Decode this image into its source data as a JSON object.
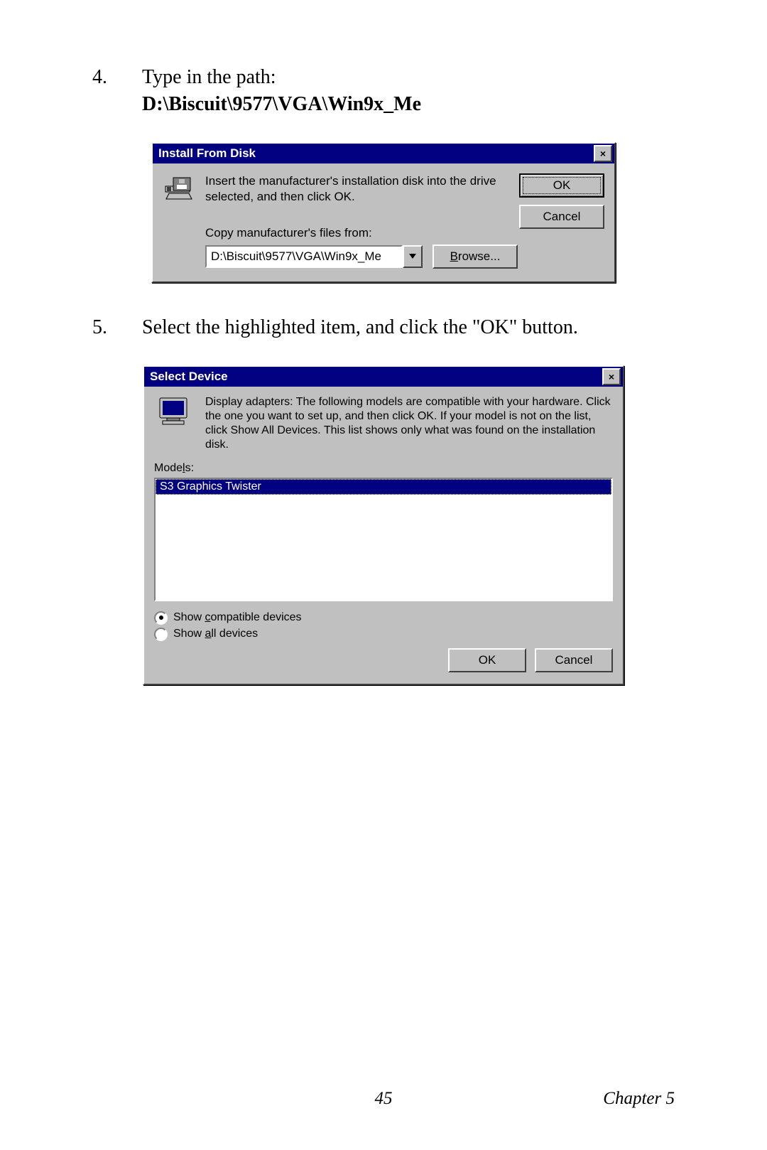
{
  "steps": [
    {
      "num": "4.",
      "text": "Type in the path:",
      "bold_line": "D:\\Biscuit\\9577\\VGA\\Win9x_Me"
    },
    {
      "num": "5.",
      "text": "Select the highlighted item, and click the \"OK\" button."
    }
  ],
  "dialog1": {
    "title": "Install From Disk",
    "instruction": "Insert the manufacturer's installation disk into the drive selected, and then click OK.",
    "ok": "OK",
    "cancel": "Cancel",
    "copy_label": "Copy manufacturer's files from:",
    "path": "D:\\Biscuit\\9577\\VGA\\Win9x_Me",
    "browse_pre": "B",
    "browse_rest": "rowse..."
  },
  "dialog2": {
    "title": "Select Device",
    "desc": "Display adapters: The following models are compatible with your hardware. Click the one you want to set up, and then click OK. If your model is not on the list, click Show All Devices. This list shows only what was found on the installation disk.",
    "models_pre": "Mode",
    "models_u": "l",
    "models_post": "s:",
    "model_item": "S3 Graphics Twister",
    "radio1_pre": "Show ",
    "radio1_u": "c",
    "radio1_post": "ompatible devices",
    "radio2_pre": "Show ",
    "radio2_u": "a",
    "radio2_post": "ll devices",
    "ok": "OK",
    "cancel": "Cancel"
  },
  "footer": {
    "page_num": "45",
    "chapter": "Chapter 5"
  }
}
